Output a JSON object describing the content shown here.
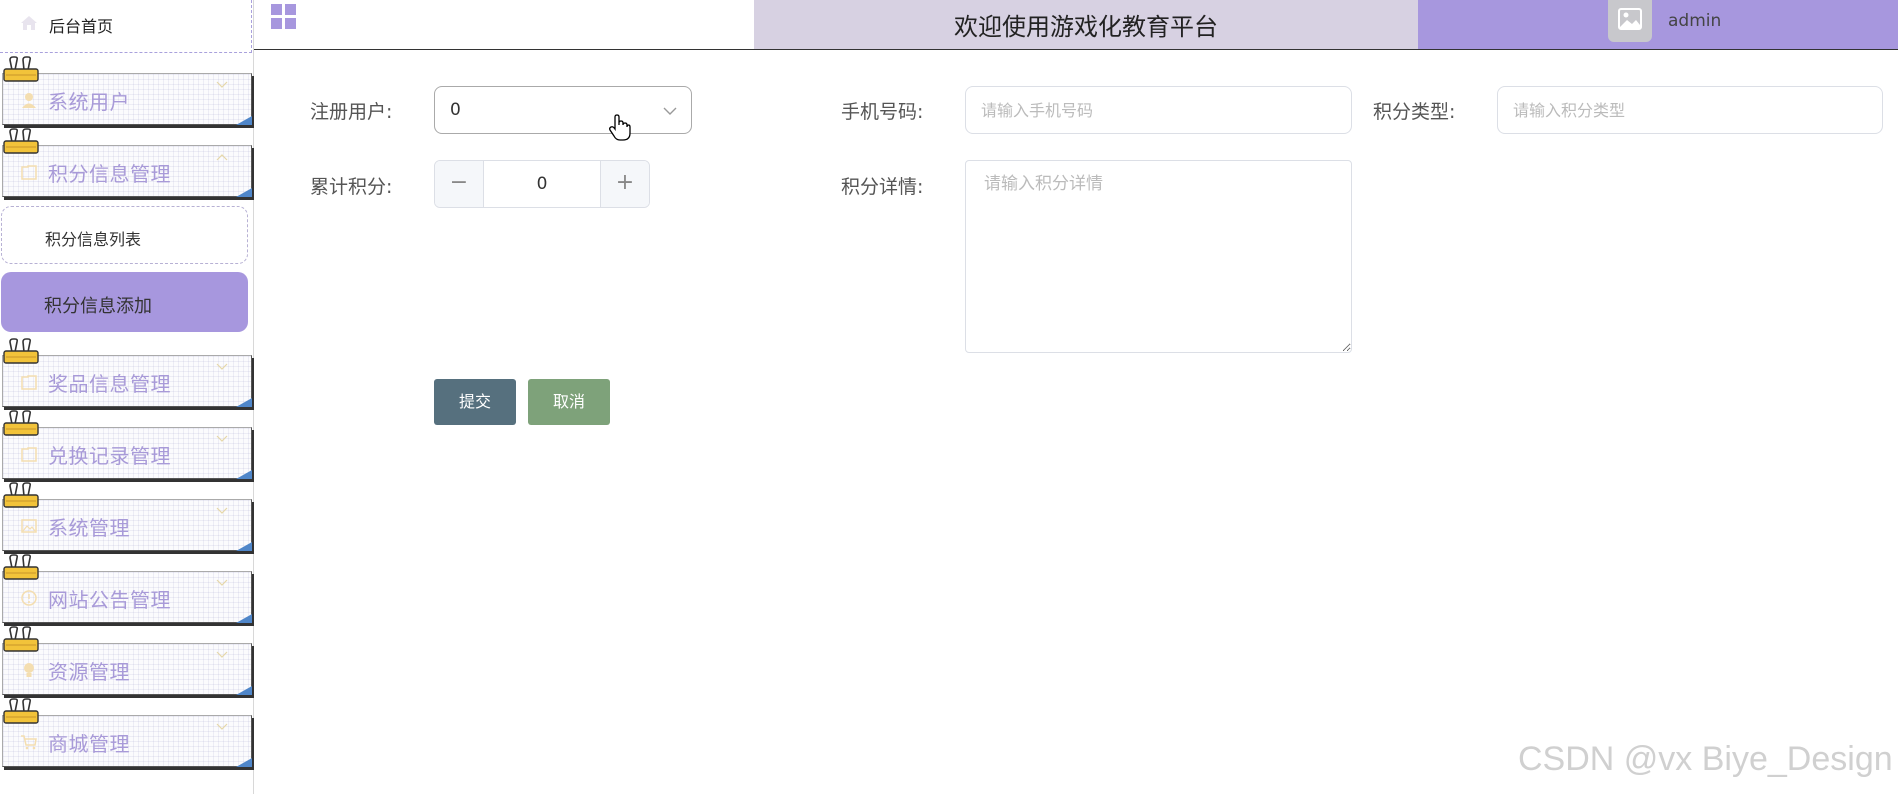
{
  "header": {
    "title": "欢迎使用游戏化教育平台",
    "username": "admin"
  },
  "sidebar": {
    "home_label": "后台首页",
    "menus": [
      {
        "label": "系统用户",
        "icon": "user-icon"
      },
      {
        "label": "积分信息管理",
        "icon": "folder-icon",
        "expanded": true
      },
      {
        "label": "奖品信息管理",
        "icon": "folder-icon"
      },
      {
        "label": "兑换记录管理",
        "icon": "folder-icon"
      },
      {
        "label": "系统管理",
        "icon": "image-icon"
      },
      {
        "label": "网站公告管理",
        "icon": "info-icon"
      },
      {
        "label": "资源管理",
        "icon": "lightbulb-icon"
      },
      {
        "label": "商城管理",
        "icon": "cart-icon"
      }
    ],
    "submenu": {
      "list_label": "积分信息列表",
      "add_label": "积分信息添加"
    }
  },
  "form": {
    "user_label": "注册用户:",
    "user_value": "0",
    "phone_label": "手机号码:",
    "phone_placeholder": "请输入手机号码",
    "type_label": "积分类型:",
    "type_placeholder": "请输入积分类型",
    "total_label": "累计积分:",
    "total_value": "0",
    "detail_label": "积分详情:",
    "detail_placeholder": "请输入积分详情",
    "submit_label": "提交",
    "cancel_label": "取消"
  },
  "watermark": "CSDN @vx Biye_Design",
  "colors": {
    "accent": "#a797de",
    "title_band": "#d7d1e2",
    "submit": "#56707e",
    "cancel": "#7ea27a",
    "menu_text": "#a89ad8"
  }
}
